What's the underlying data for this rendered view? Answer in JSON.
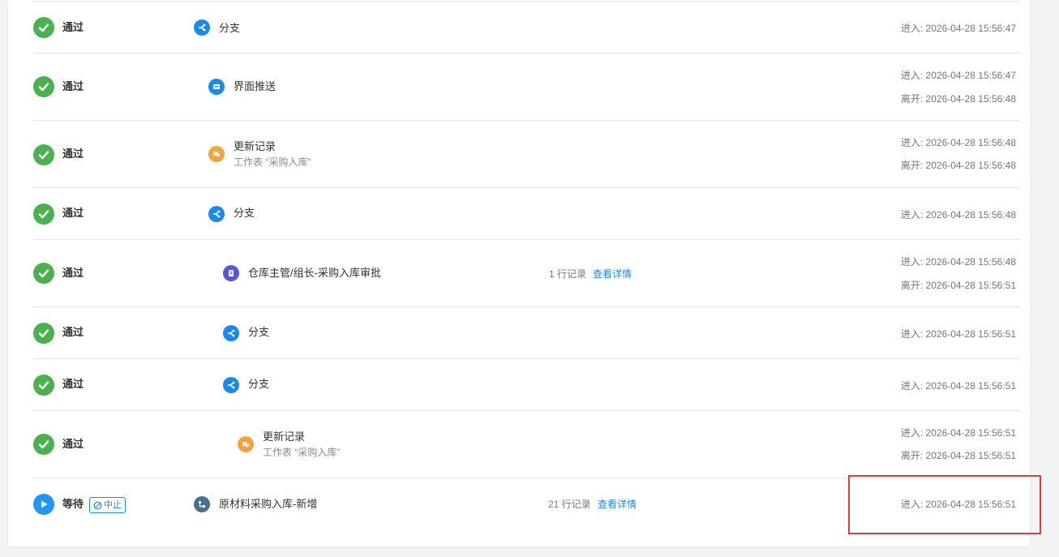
{
  "colors": {
    "pass": "#4caf50",
    "wait": "#2196f3",
    "branch": "#1e88e5",
    "update": "#f5a242",
    "approval": "#5b56d6",
    "subprocess": "#4a6f8a",
    "link": "#1e88e5",
    "highlight": "#e53935"
  },
  "labels": {
    "enter_prefix": "进入: ",
    "leave_prefix": "离开: "
  },
  "rows": [
    {
      "status": "pass",
      "status_label": "通过",
      "node_icon": "branch-icon",
      "node_title": "分支",
      "enter": "进入: 2026-04-28 15:56:47"
    },
    {
      "status": "pass",
      "status_label": "通过",
      "node_icon": "push-icon",
      "node_title": "界面推送",
      "enter": "进入: 2026-04-28 15:56:47",
      "leave": "离开: 2026-04-28 15:56:48"
    },
    {
      "status": "pass",
      "status_label": "通过",
      "node_icon": "update-record-icon",
      "node_title": "更新记录",
      "node_sub": "工作表 “采购入库”",
      "enter": "进入: 2026-04-28 15:56:48",
      "leave": "离开: 2026-04-28 15:56:48"
    },
    {
      "status": "pass",
      "status_label": "通过",
      "node_icon": "branch-icon",
      "node_title": "分支",
      "enter": "进入: 2026-04-28 15:56:48"
    },
    {
      "status": "pass",
      "status_label": "通过",
      "node_icon": "approval-icon",
      "node_title": "仓库主管/组长-采购入库审批",
      "records": "1 行记录",
      "detail": "查看详情",
      "enter": "进入: 2026-04-28 15:56:48",
      "leave": "离开: 2026-04-28 15:56:51"
    },
    {
      "status": "pass",
      "status_label": "通过",
      "node_icon": "branch-icon",
      "node_title": "分支",
      "enter": "进入: 2026-04-28 15:56:51"
    },
    {
      "status": "pass",
      "status_label": "通过",
      "node_icon": "branch-icon",
      "node_title": "分支",
      "enter": "进入: 2026-04-28 15:56:51"
    },
    {
      "status": "pass",
      "status_label": "通过",
      "node_icon": "update-record-icon",
      "node_title": "更新记录",
      "node_sub": "工作表 “采购入库”",
      "enter": "进入: 2026-04-28 15:56:51",
      "leave": "离开: 2026-04-28 15:56:51"
    },
    {
      "status": "wait",
      "status_label": "等待",
      "stop_label": "中止",
      "node_icon": "subprocess-icon",
      "node_title": "原材料采购入库-新增",
      "records": "21 行记录",
      "detail": "查看详情",
      "enter": "进入: 2026-04-28 15:56:51"
    }
  ]
}
